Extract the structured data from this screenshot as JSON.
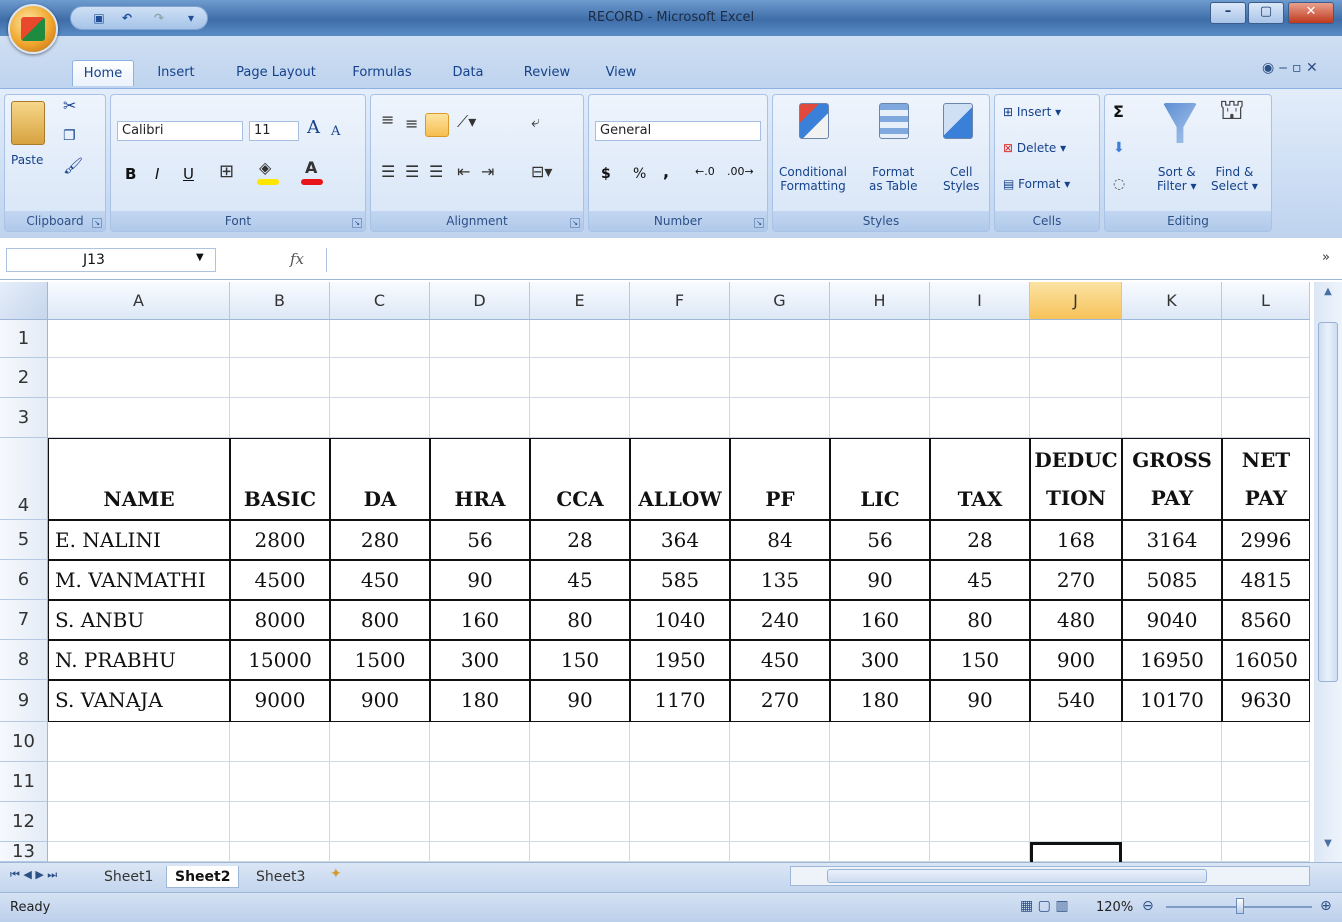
{
  "window": {
    "title": "RECORD - Microsoft Excel"
  },
  "tabs": [
    "Home",
    "Insert",
    "Page Layout",
    "Formulas",
    "Data",
    "Review",
    "View"
  ],
  "clipboard": {
    "paste": "Paste",
    "label": "Clipboard"
  },
  "font": {
    "name": "Calibri",
    "size": "11",
    "label": "Font",
    "bold": "B",
    "italic": "I",
    "underline": "U",
    "grow": "A",
    "shrink": "A"
  },
  "alignment": {
    "label": "Alignment"
  },
  "number": {
    "format": "General",
    "label": "Number",
    "currency": "$",
    "percent": "%",
    "comma": ","
  },
  "styles": {
    "conditional_1": "Conditional",
    "conditional_2": "Formatting",
    "format_table_1": "Format",
    "format_table_2": "as Table",
    "cell_styles_1": "Cell",
    "cell_styles_2": "Styles",
    "label": "Styles"
  },
  "cells": {
    "insert": "Insert",
    "delete": "Delete",
    "format": "Format",
    "label": "Cells"
  },
  "editing": {
    "sort_1": "Sort &",
    "sort_2": "Filter",
    "find_1": "Find &",
    "find_2": "Select",
    "label": "Editing",
    "sigma": "Σ"
  },
  "formula_bar": {
    "name_box": "J13",
    "fx": "fx",
    "value": ""
  },
  "columns": [
    "A",
    "B",
    "C",
    "D",
    "E",
    "F",
    "G",
    "H",
    "I",
    "J",
    "K",
    "L"
  ],
  "selected_column": "J",
  "rows": [
    "1",
    "2",
    "3",
    "4",
    "5",
    "6",
    "7",
    "8",
    "9",
    "10",
    "11",
    "12",
    "13"
  ],
  "table": {
    "headers": [
      "NAME",
      "BASIC",
      "DA",
      "HRA",
      "CCA",
      "ALLOW",
      "PF",
      "LIC",
      "TAX",
      [
        "DEDUC",
        "TION"
      ],
      [
        "GROSS",
        "PAY"
      ],
      [
        "NET",
        "PAY"
      ]
    ],
    "data": [
      [
        "E. NALINI",
        "2800",
        "280",
        "56",
        "28",
        "364",
        "84",
        "56",
        "28",
        "168",
        "3164",
        "2996"
      ],
      [
        "M. VANMATHI",
        "4500",
        "450",
        "90",
        "45",
        "585",
        "135",
        "90",
        "45",
        "270",
        "5085",
        "4815"
      ],
      [
        "S. ANBU",
        "8000",
        "800",
        "160",
        "80",
        "1040",
        "240",
        "160",
        "80",
        "480",
        "9040",
        "8560"
      ],
      [
        "N. PRABHU",
        "15000",
        "1500",
        "300",
        "150",
        "1950",
        "450",
        "300",
        "150",
        "900",
        "16950",
        "16050"
      ],
      [
        "S. VANAJA",
        "9000",
        "900",
        "180",
        "90",
        "1170",
        "270",
        "180",
        "90",
        "540",
        "10170",
        "9630"
      ]
    ]
  },
  "sheets": [
    "Sheet1",
    "Sheet2",
    "Sheet3"
  ],
  "active_sheet": "Sheet2",
  "status": {
    "ready": "Ready",
    "zoom": "120%"
  }
}
